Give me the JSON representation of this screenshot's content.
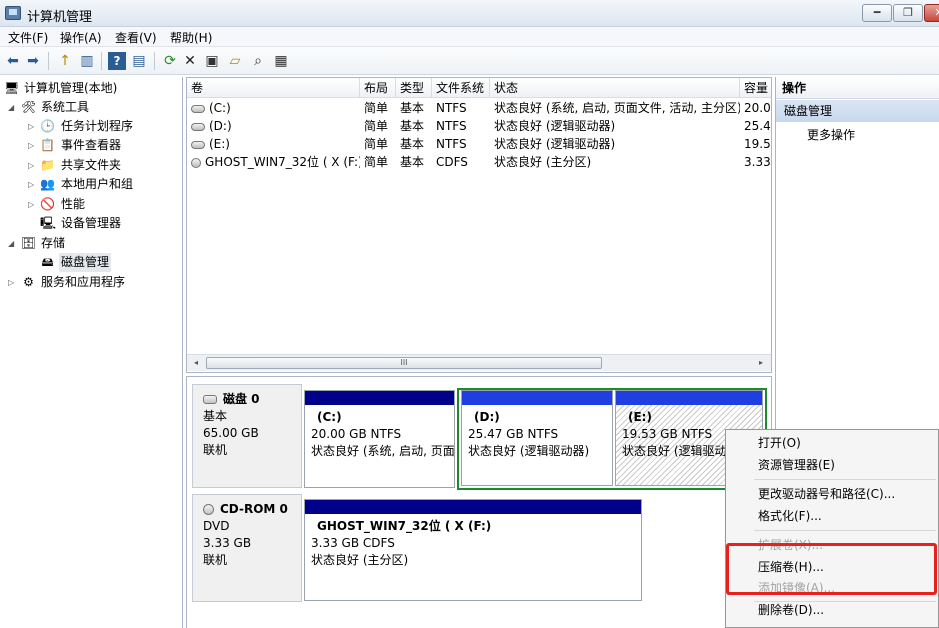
{
  "window": {
    "title": "计算机管理",
    "min_glyph": "━",
    "max_glyph": "❐",
    "close_glyph": "✕"
  },
  "menu": [
    "文件(F)",
    "操作(A)",
    "查看(V)",
    "帮助(H)"
  ],
  "toolbar": {
    "back": "⬅",
    "forward": "➡",
    "up": "↑",
    "show_tree": "▥",
    "help": "?",
    "view": "▤",
    "refresh": "⟳",
    "delete": "✕",
    "properties": "▣",
    "open": "▱",
    "search": "⌕",
    "export": "▦"
  },
  "tree": {
    "root": "计算机管理(本地)",
    "system_tools": "系统工具",
    "task_scheduler": "任务计划程序",
    "event_viewer": "事件查看器",
    "shared_folders": "共享文件夹",
    "local_users": "本地用户和组",
    "performance": "性能",
    "device_manager": "设备管理器",
    "storage": "存储",
    "disk_management": "磁盘管理",
    "services": "服务和应用程序"
  },
  "volume_table": {
    "columns": [
      "卷",
      "布局",
      "类型",
      "文件系统",
      "状态",
      "容量"
    ],
    "rows": [
      [
        "(C:)",
        "简单",
        "基本",
        "NTFS",
        "状态良好 (系统, 启动, 页面文件, 活动, 主分区)",
        "20.0"
      ],
      [
        "(D:)",
        "简单",
        "基本",
        "NTFS",
        "状态良好 (逻辑驱动器)",
        "25.4"
      ],
      [
        "(E:)",
        "简单",
        "基本",
        "NTFS",
        "状态良好 (逻辑驱动器)",
        "19.5"
      ],
      [
        "GHOST_WIN7_32位 ( X (F:)",
        "简单",
        "基本",
        "CDFS",
        "状态良好 (主分区)",
        "3.33"
      ]
    ],
    "scroll_left": "◂",
    "scroll_right": "▸",
    "scroll_grip": "III"
  },
  "disk_map": {
    "disk0": {
      "name": "磁盘 0",
      "type": "基本",
      "size": "65.00 GB",
      "status": "联机",
      "partitions": [
        {
          "name": "(C:)",
          "size": "20.00 GB NTFS",
          "status": "状态良好 (系统, 启动, 页面"
        },
        {
          "name": "(D:)",
          "size": "25.47 GB NTFS",
          "status": "状态良好 (逻辑驱动器)"
        },
        {
          "name": "(E:)",
          "size": "19.53 GB NTFS",
          "status": "状态良好 (逻辑驱动器)"
        }
      ]
    },
    "cdrom0": {
      "name": "CD-ROM 0",
      "type": "DVD",
      "size": "3.33 GB",
      "status": "联机",
      "partition": {
        "name": "GHOST_WIN7_32位 ( X  (F:)",
        "size": "3.33 GB CDFS",
        "status": "状态良好 (主分区)"
      }
    }
  },
  "actions": {
    "header": "操作",
    "section": "磁盘管理",
    "more": "更多操作"
  },
  "context_menu": {
    "open": "打开(O)",
    "explorer": "资源管理器(E)",
    "change_letter": "更改驱动器号和路径(C)...",
    "format": "格式化(F)...",
    "extend": "扩展卷(X)...",
    "shrink": "压缩卷(H)...",
    "mirror": "添加镜像(A)...",
    "delete": "删除卷(D)..."
  },
  "colors": {
    "primary_bar": "#00008b",
    "logical_bar": "#1f3fe0",
    "selection_frame": "#1d8a2f",
    "highlight": "#e8211c"
  }
}
